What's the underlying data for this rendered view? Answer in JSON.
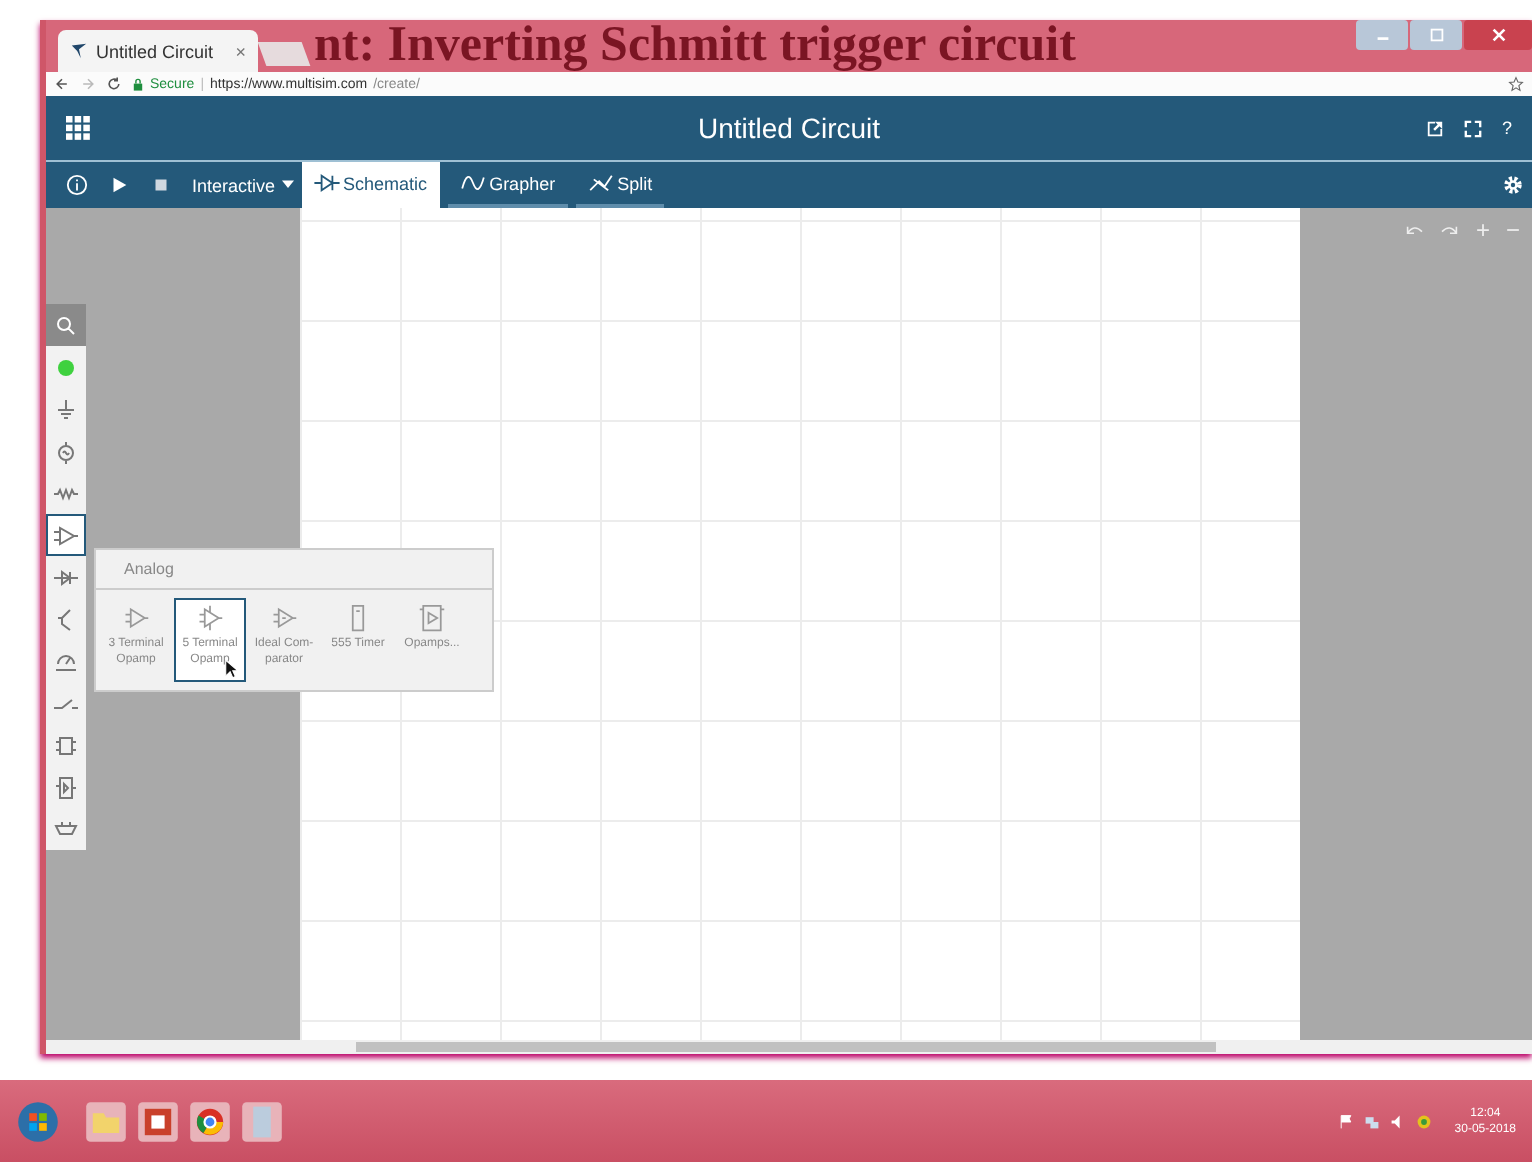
{
  "backdrop": {
    "slide_title": "nt: Inverting Schmitt trigger circuit"
  },
  "browser": {
    "tab_title": "Untitled Circuit",
    "tab_close": "×",
    "secure_label": "Secure",
    "separator": "|",
    "url_host": "https://www.multisim.com",
    "url_path": "/create/"
  },
  "app": {
    "title": "Untitled Circuit",
    "help": "?"
  },
  "toolbar": {
    "mode": "Interactive",
    "tabs": [
      {
        "label": "Schematic",
        "kind": "schematic",
        "selected": true
      },
      {
        "label": "Grapher",
        "kind": "grapher",
        "selected": false
      },
      {
        "label": "Split",
        "kind": "split",
        "selected": false
      }
    ]
  },
  "tools": [
    {
      "kind": "search",
      "selected": false
    },
    {
      "kind": "probe",
      "selected": false
    },
    {
      "kind": "ground",
      "selected": false
    },
    {
      "kind": "source",
      "selected": false
    },
    {
      "kind": "resistor",
      "selected": false
    },
    {
      "kind": "opamp",
      "selected": true
    },
    {
      "kind": "diode",
      "selected": false
    },
    {
      "kind": "transistor",
      "selected": false
    },
    {
      "kind": "meter",
      "selected": false
    },
    {
      "kind": "switch",
      "selected": false
    },
    {
      "kind": "chip",
      "selected": false
    },
    {
      "kind": "chip2",
      "selected": false
    },
    {
      "kind": "connector",
      "selected": false
    }
  ],
  "palette": {
    "title": "Analog",
    "items": [
      {
        "label": "3 Terminal Opamp",
        "kind": "opamp",
        "selected": false
      },
      {
        "label": "5 Terminal Opamp",
        "kind": "opamp5",
        "selected": true
      },
      {
        "label": "Ideal Com-parator",
        "kind": "comparator",
        "selected": false
      },
      {
        "label": "555 Timer",
        "kind": "timer",
        "selected": false
      },
      {
        "label": "Opamps...",
        "kind": "folder",
        "selected": false
      }
    ]
  },
  "zoom_controls": [
    "+",
    "−"
  ],
  "taskbar": {
    "time": "12:04",
    "date": "30-05-2018"
  }
}
